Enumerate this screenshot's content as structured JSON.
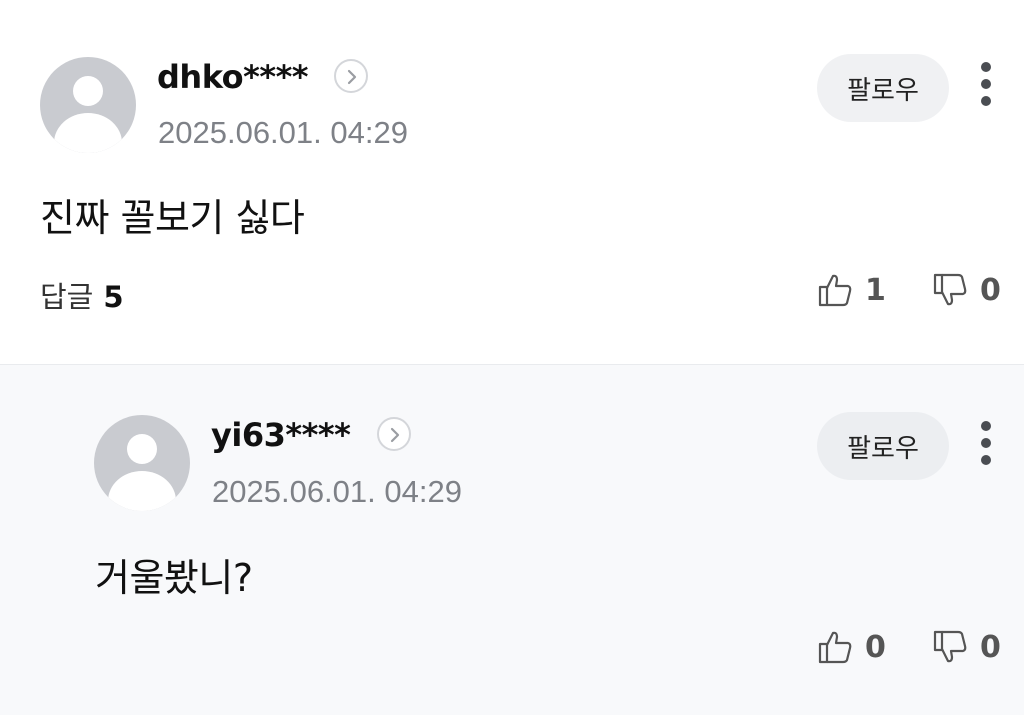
{
  "comments": [
    {
      "nickname": "dhko****",
      "date": "2025.06.01. 04:29",
      "follow_label": "팔로우",
      "text": "진짜 꼴보기 싫다",
      "reply_label": "답글",
      "reply_count": "5",
      "likes": "1",
      "dislikes": "0"
    }
  ],
  "replies": [
    {
      "nickname": "yi63****",
      "date": "2025.06.01. 04:29",
      "follow_label": "팔로우",
      "text": "거울봤니?",
      "likes": "0",
      "dislikes": "0"
    }
  ],
  "icons": {
    "avatar": "default-profile-icon",
    "profile_link": "chevron-right-icon",
    "more": "more-vertical-icon",
    "like": "thumbs-up-icon",
    "dislike": "thumbs-down-icon"
  },
  "colors": {
    "reply_background": "#f8f9fb",
    "follow_button": "#f0f1f3",
    "avatar_gray": "#c9cbd0",
    "date_gray": "#7e8187"
  }
}
